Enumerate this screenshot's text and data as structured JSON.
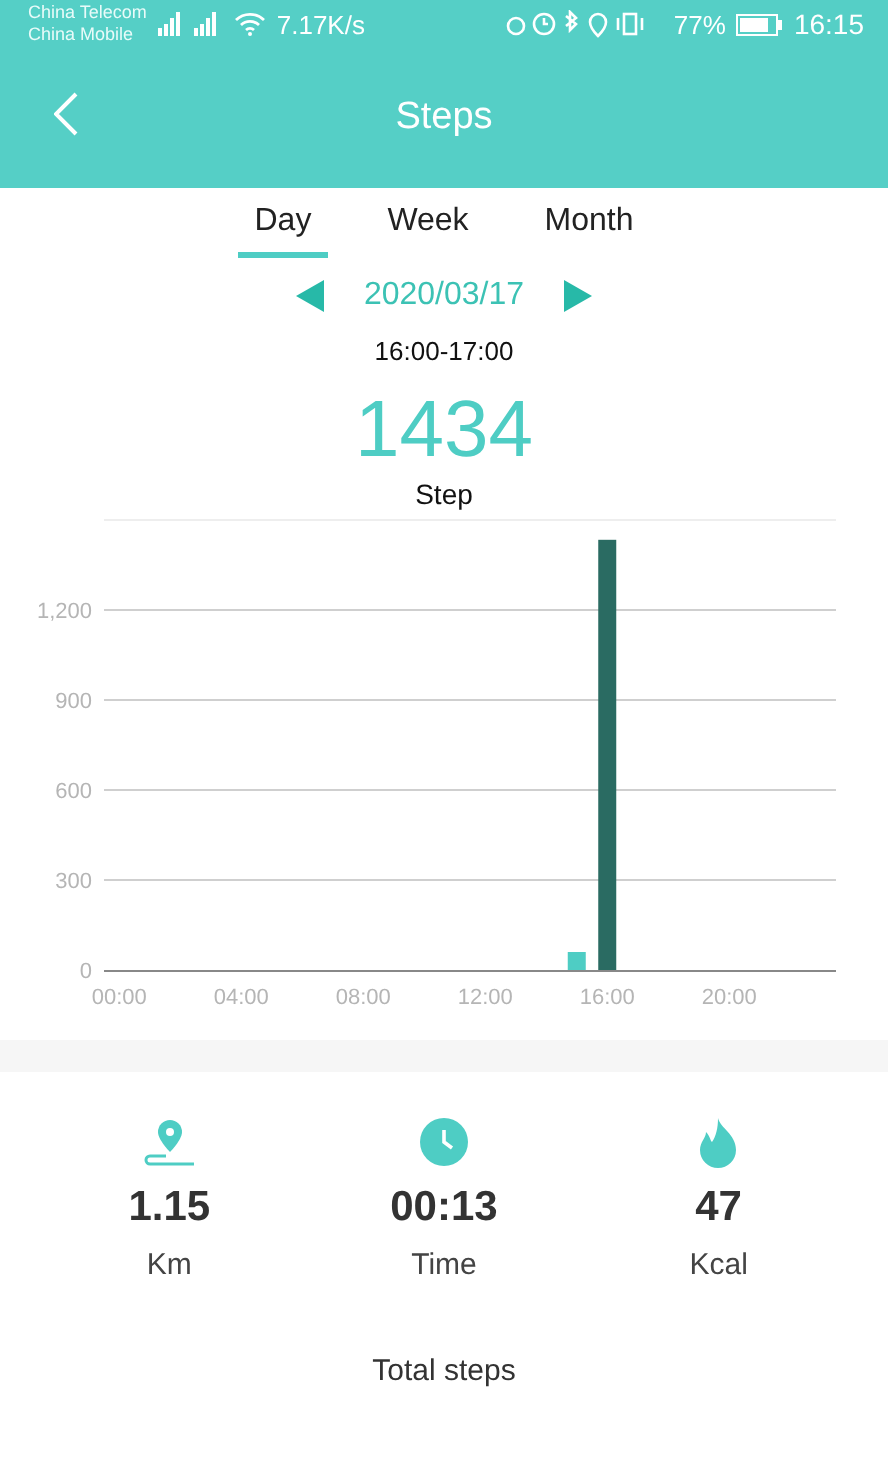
{
  "status_bar": {
    "carriers": [
      "China Telecom",
      "China Mobile"
    ],
    "speed": "7.17K/s",
    "battery": "77%",
    "time": "16:15"
  },
  "header": {
    "title": "Steps"
  },
  "tabs": [
    {
      "label": "Day",
      "selected": true
    },
    {
      "label": "Week",
      "selected": false
    },
    {
      "label": "Month",
      "selected": false
    }
  ],
  "date": "2020/03/17",
  "period": "16:00-17:00",
  "total": "1434",
  "unit": "Step",
  "chart_data": {
    "type": "bar",
    "stacked": true,
    "grid": true,
    "x": [
      0,
      1,
      2,
      3,
      4,
      5,
      6,
      7,
      8,
      9,
      10,
      11,
      12,
      13,
      14,
      15,
      16,
      17,
      18,
      19,
      20,
      21,
      22,
      23
    ],
    "xlim": [
      -0.5,
      23.5
    ],
    "ylim": [
      0,
      1500
    ],
    "series": [
      {
        "color": "#4ecdc4",
        "values": [
          0,
          0,
          0,
          0,
          0,
          0,
          0,
          0,
          0,
          0,
          0,
          0,
          0,
          0,
          0,
          60,
          0,
          0,
          0,
          0,
          0,
          0,
          0,
          0
        ]
      },
      {
        "color": "#2a6b62",
        "values": [
          0,
          0,
          0,
          0,
          0,
          0,
          0,
          0,
          0,
          0,
          0,
          0,
          0,
          0,
          0,
          0,
          1434,
          0,
          0,
          0,
          0,
          0,
          0,
          0
        ]
      }
    ],
    "yticks": [
      {
        "value": 0,
        "label": "0"
      },
      {
        "value": 300,
        "label": "300"
      },
      {
        "value": 600,
        "label": "600"
      },
      {
        "value": 900,
        "label": "900"
      },
      {
        "value": 1200,
        "label": "1,200"
      }
    ],
    "xticks": [
      {
        "value": 0,
        "label": "00:00"
      },
      {
        "value": 4,
        "label": "04:00"
      },
      {
        "value": 8,
        "label": "08:00"
      },
      {
        "value": 12,
        "label": "12:00"
      },
      {
        "value": 16,
        "label": "16:00"
      },
      {
        "value": 20,
        "label": "20:00"
      }
    ]
  },
  "stats": [
    {
      "kind": "distance",
      "value": "1.15",
      "label": "Km"
    },
    {
      "kind": "time",
      "value": "00:13",
      "label": "Time"
    },
    {
      "kind": "calories",
      "value": "47",
      "label": "Kcal"
    }
  ],
  "footer": "Total steps"
}
